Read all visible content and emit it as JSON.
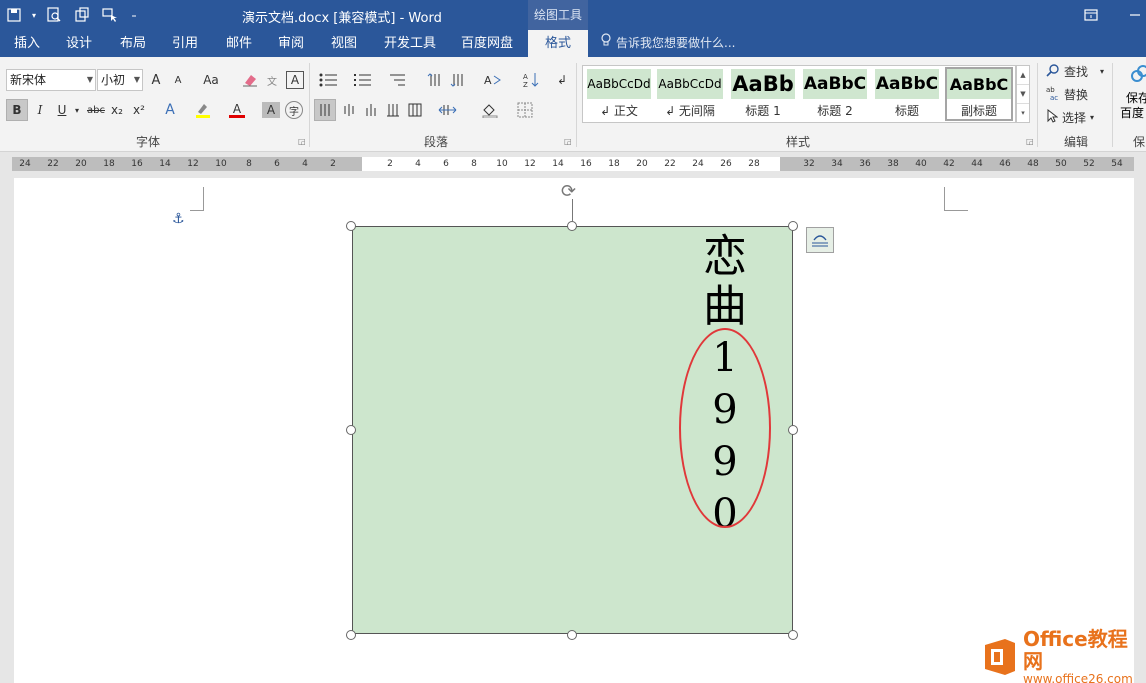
{
  "title_bar": {
    "document_title": "演示文档.docx [兼容模式] - Word",
    "context_tool": "绘图工具",
    "qat_icons": [
      "save-icon",
      "print-preview-icon",
      "new-window-icon",
      "touch-mode-icon",
      "customize-icon"
    ],
    "window_icons": [
      "ribbon-display-icon",
      "minimize-icon"
    ]
  },
  "tabs": [
    {
      "label": "插入"
    },
    {
      "label": "设计"
    },
    {
      "label": "布局"
    },
    {
      "label": "引用"
    },
    {
      "label": "邮件"
    },
    {
      "label": "审阅"
    },
    {
      "label": "视图"
    },
    {
      "label": "开发工具"
    },
    {
      "label": "百度网盘"
    },
    {
      "label": "格式",
      "active": true
    }
  ],
  "tell_me": "告诉我您想要做什么...",
  "ribbon": {
    "font": {
      "label": "字体",
      "font_name": "新宋体",
      "font_size": "小初",
      "buttons": [
        "A",
        "A",
        "Aa",
        "B",
        "I",
        "U",
        "abc",
        "x₂",
        "x²",
        "A",
        "A",
        "A",
        "字"
      ]
    },
    "paragraph": {
      "label": "段落"
    },
    "styles": {
      "label": "样式",
      "items": [
        {
          "sample": "AaBbCcDd",
          "name": "↲ 正文"
        },
        {
          "sample": "AaBbCcDd",
          "name": "↲ 无间隔"
        },
        {
          "sample": "AaBb",
          "name": "标题 1"
        },
        {
          "sample": "AaBbC",
          "name": "标题 2"
        },
        {
          "sample": "AaBbC",
          "name": "标题"
        },
        {
          "sample": "AaBbC",
          "name": "副标题",
          "selected": true
        }
      ]
    },
    "editing": {
      "label": "编辑",
      "find": "查找",
      "replace": "替换",
      "select": "选择"
    },
    "save_group": {
      "line1": "保存",
      "line2": "百度",
      "label": "保"
    }
  },
  "ruler": {
    "left_ticks": [
      "24",
      "22",
      "20",
      "18",
      "16",
      "14",
      "12",
      "10",
      "8",
      "6",
      "4",
      "2"
    ],
    "mid_ticks": [
      "2",
      "4",
      "6",
      "8",
      "10",
      "12",
      "14",
      "16",
      "18",
      "20",
      "22",
      "24",
      "26",
      "28"
    ],
    "right_ticks": [
      "32",
      "34",
      "36",
      "38",
      "40",
      "42",
      "44",
      "46",
      "48",
      "50",
      "52",
      "54"
    ]
  },
  "document": {
    "vertical_text_chars": [
      "恋",
      "曲"
    ],
    "vertical_text_digits": [
      "1",
      "9",
      "9",
      "0"
    ],
    "shape_fill": "#cde6cd",
    "highlight_ellipse_color": "#e0383a"
  },
  "watermark": {
    "line1": "Office教程网",
    "line2": "www.office26.com"
  },
  "colors": {
    "title_bar": "#2b579a",
    "ribbon": "#f3f3f3"
  }
}
